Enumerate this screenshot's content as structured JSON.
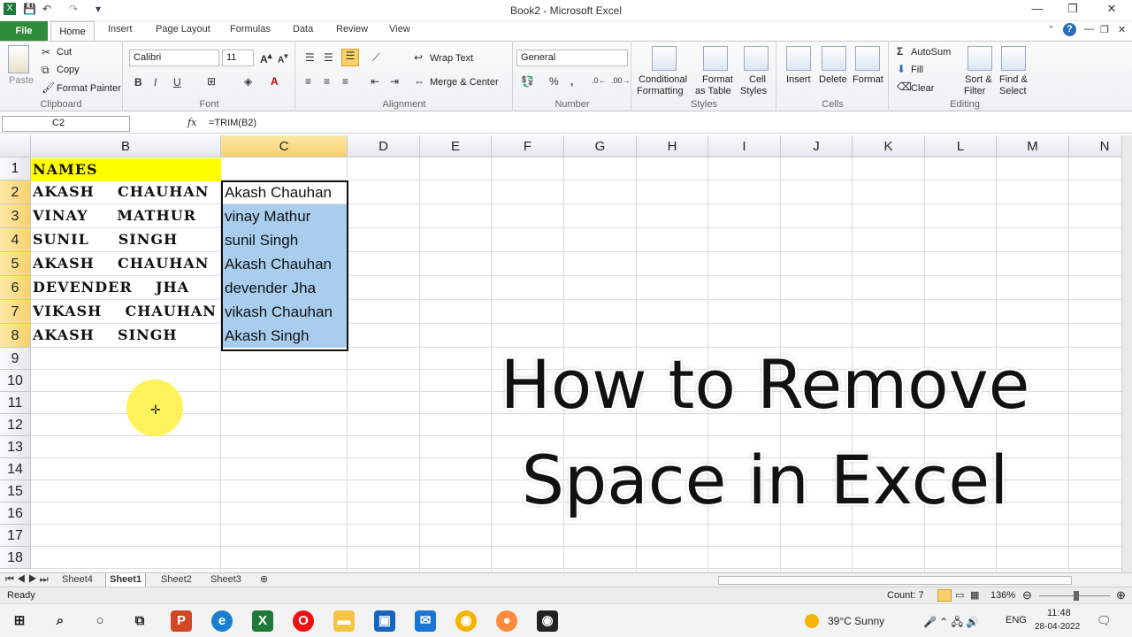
{
  "window": {
    "title": "Book2 - Microsoft Excel"
  },
  "tabs": [
    "File",
    "Home",
    "Insert",
    "Page Layout",
    "Formulas",
    "Data",
    "Review",
    "View"
  ],
  "ribbon": {
    "clipboard": {
      "paste": "Paste",
      "cut": "Cut",
      "copy": "Copy",
      "format_painter": "Format Painter",
      "label": "Clipboard"
    },
    "font": {
      "name": "Calibri",
      "size": "11",
      "label": "Font"
    },
    "alignment": {
      "wrap": "Wrap Text",
      "merge": "Merge & Center",
      "label": "Alignment"
    },
    "number": {
      "format": "General",
      "label": "Number"
    },
    "styles": {
      "conditional": [
        "Conditional",
        "Formatting"
      ],
      "format_table": [
        "Format",
        "as Table"
      ],
      "cell_styles": [
        "Cell",
        "Styles"
      ],
      "label": "Styles"
    },
    "cells": {
      "insert": "Insert",
      "delete": "Delete",
      "format": "Format",
      "label": "Cells"
    },
    "editing": {
      "autosum": "AutoSum",
      "fill": "Fill",
      "clear": "Clear",
      "sort": [
        "Sort &",
        "Filter"
      ],
      "find": [
        "Find &",
        "Select"
      ],
      "label": "Editing"
    }
  },
  "formula_bar": {
    "cell": "C2",
    "fx": "fx",
    "formula": "=TRIM(B2)"
  },
  "columns": [
    "B",
    "C",
    "D",
    "E",
    "F",
    "G",
    "H",
    "I",
    "J",
    "K",
    "L",
    "M",
    "N"
  ],
  "rows": [
    "1",
    "2",
    "3",
    "4",
    "5",
    "6",
    "7",
    "8",
    "9",
    "10",
    "11",
    "12",
    "13",
    "14",
    "15",
    "16",
    "17",
    "18"
  ],
  "header_cell": "NAMES",
  "col_b": [
    "AKASH    CHAUHAN",
    "VINAY     MATHUR",
    "SUNIL     SINGH",
    "AKASH    CHAUHAN",
    "DEVENDER    JHA",
    "VIKASH    CHAUHAN",
    "AKASH    SINGH"
  ],
  "col_c": [
    "Akash Chauhan",
    "vinay Mathur",
    "sunil Singh",
    "Akash Chauhan",
    "devender Jha",
    "vikash Chauhan",
    "Akash Singh"
  ],
  "headline": [
    "How to Remove",
    "Space in Excel"
  ],
  "sheets": [
    "Sheet4",
    "Sheet1",
    "Sheet2",
    "Sheet3"
  ],
  "active_sheet": "Sheet1",
  "status": {
    "ready": "Ready",
    "count": "Count: 7",
    "zoom": "136%"
  },
  "taskbar": {
    "weather": "39°C  Sunny",
    "lang": "ENG",
    "time": "11:48",
    "date": "28-04-2022"
  },
  "colors": {
    "file_tab": "#2e8b3c",
    "names_fill": "#ffff00",
    "selection": "#a9cdee",
    "cursor": "#fdf25a"
  }
}
